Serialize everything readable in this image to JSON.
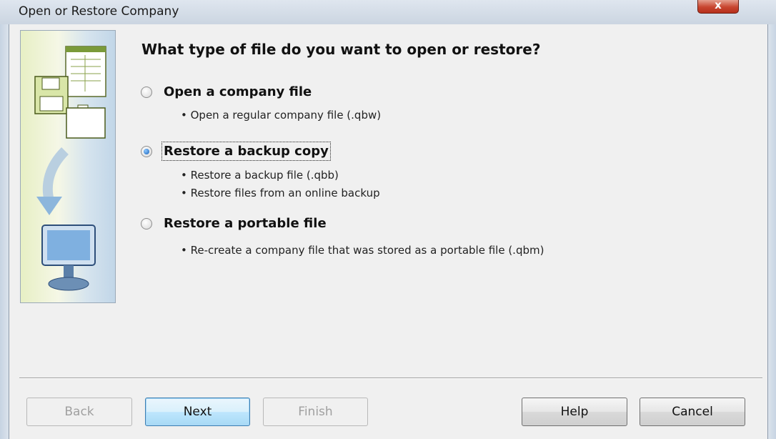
{
  "window": {
    "title": "Open or Restore Company",
    "close_glyph": "x"
  },
  "main": {
    "heading": "What type of file do you want to open or restore?",
    "options": [
      {
        "label": "Open a company file",
        "selected": false,
        "bullets": [
          "• Open a regular company file (.qbw)"
        ]
      },
      {
        "label": "Restore a backup copy",
        "selected": true,
        "bullets": [
          "• Restore a backup file (.qbb)",
          "• Restore files from an online backup"
        ]
      },
      {
        "label": "Restore a portable file",
        "selected": false,
        "bullets": [
          "• Re-create a company file that was stored as a portable file (.qbm)"
        ]
      }
    ]
  },
  "buttons": {
    "back": "Back",
    "next": "Next",
    "finish": "Finish",
    "help": "Help",
    "cancel": "Cancel"
  },
  "icons": {
    "sidebar": [
      "document-icon",
      "floppy-disk-icon",
      "folder-icon",
      "arrow-down-icon",
      "computer-monitor-icon"
    ]
  }
}
